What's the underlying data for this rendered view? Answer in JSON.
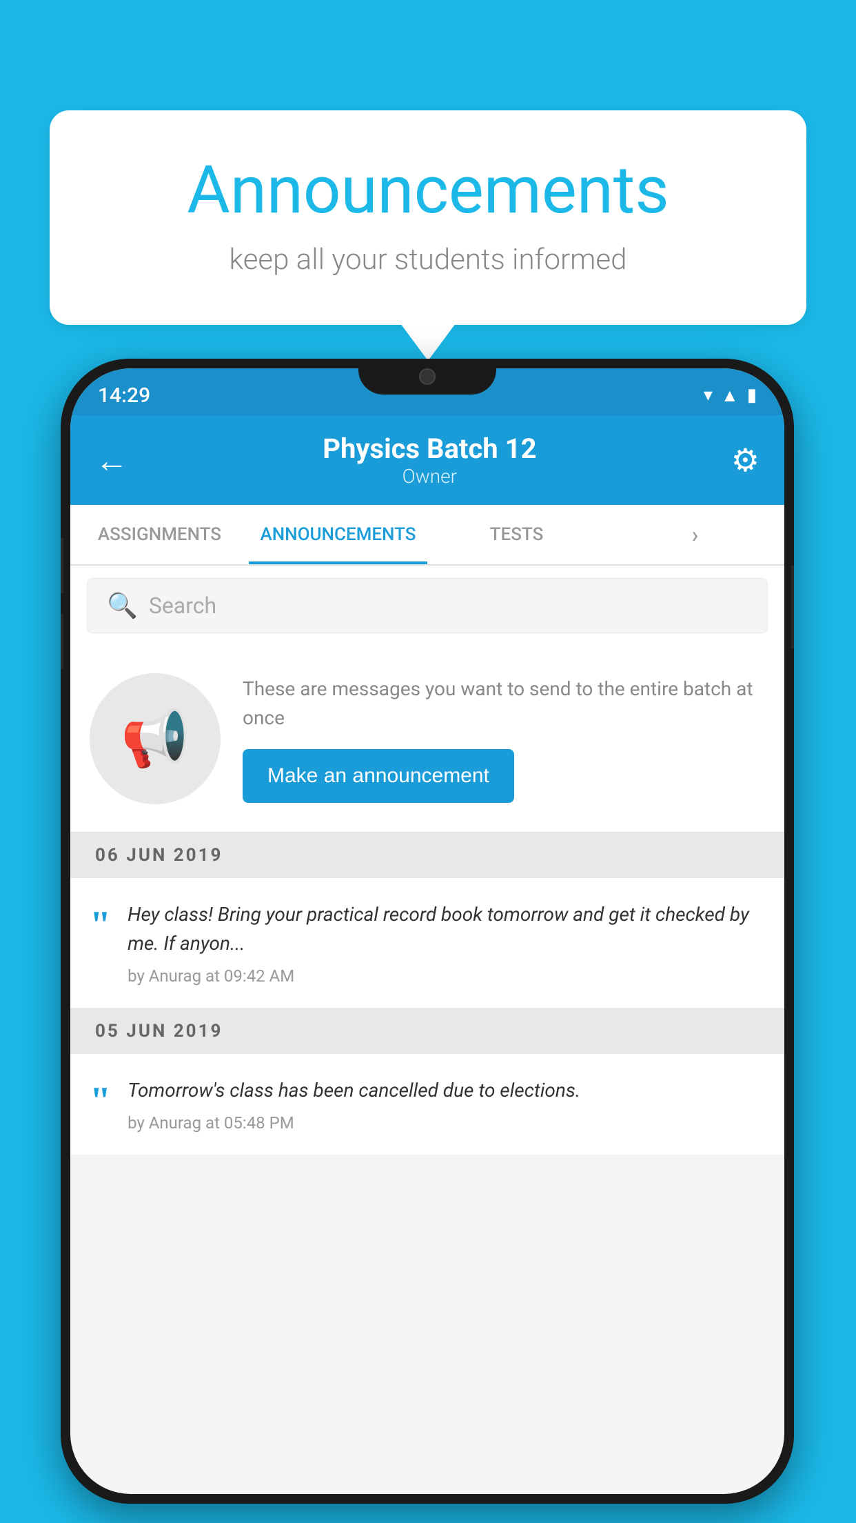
{
  "background_color": "#1BB8E8",
  "speech_bubble": {
    "title": "Announcements",
    "subtitle": "keep all your students informed"
  },
  "phone": {
    "status_bar": {
      "time": "14:29",
      "icons": [
        "wifi",
        "signal",
        "battery"
      ]
    },
    "header": {
      "title": "Physics Batch 12",
      "subtitle": "Owner",
      "back_label": "←",
      "gear_label": "⚙"
    },
    "tabs": [
      {
        "label": "ASSIGNMENTS",
        "active": false
      },
      {
        "label": "ANNOUNCEMENTS",
        "active": true
      },
      {
        "label": "TESTS",
        "active": false
      },
      {
        "label": "›",
        "active": false
      }
    ],
    "search": {
      "placeholder": "Search"
    },
    "announcement_prompt": {
      "icon": "📢",
      "description": "These are messages you want to send to the entire batch at once",
      "button_label": "Make an announcement"
    },
    "announcements": [
      {
        "date": "06  JUN  2019",
        "text": "Hey class! Bring your practical record book tomorrow and get it checked by me. If anyon...",
        "meta": "by Anurag at 09:42 AM"
      },
      {
        "date": "05  JUN  2019",
        "text": "Tomorrow's class has been cancelled due to elections.",
        "meta": "by Anurag at 05:48 PM"
      }
    ]
  }
}
